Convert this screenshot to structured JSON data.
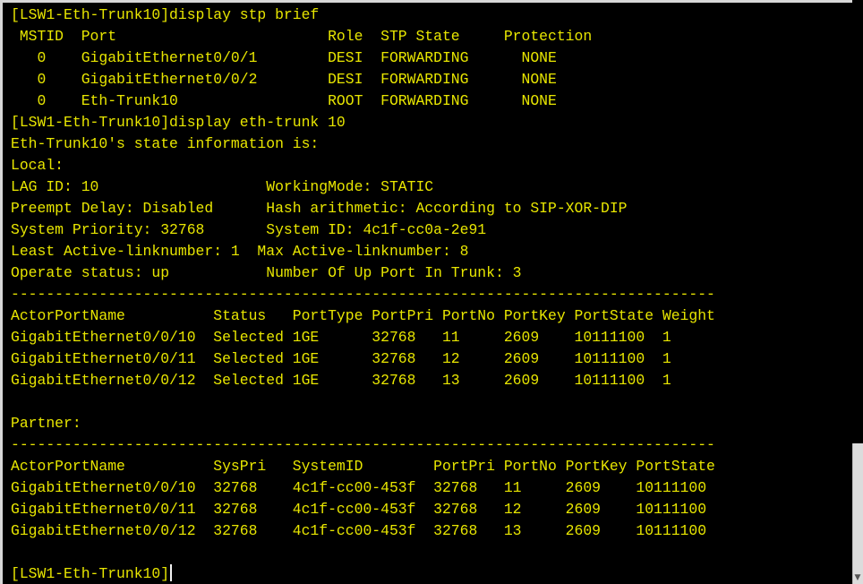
{
  "terminal": {
    "lines": [
      "[LSW1-Eth-Trunk10]display stp brief",
      " MSTID  Port                        Role  STP State     Protection",
      "   0    GigabitEthernet0/0/1        DESI  FORWARDING      NONE",
      "   0    GigabitEthernet0/0/2        DESI  FORWARDING      NONE",
      "   0    Eth-Trunk10                 ROOT  FORWARDING      NONE",
      "[LSW1-Eth-Trunk10]display eth-trunk 10",
      "Eth-Trunk10's state information is:",
      "Local:",
      "LAG ID: 10                   WorkingMode: STATIC",
      "Preempt Delay: Disabled      Hash arithmetic: According to SIP-XOR-DIP",
      "System Priority: 32768       System ID: 4c1f-cc0a-2e91",
      "Least Active-linknumber: 1  Max Active-linknumber: 8",
      "Operate status: up           Number Of Up Port In Trunk: 3",
      "--------------------------------------------------------------------------------",
      "ActorPortName          Status   PortType PortPri PortNo PortKey PortState Weight",
      "GigabitEthernet0/0/10  Selected 1GE      32768   11     2609    10111100  1",
      "GigabitEthernet0/0/11  Selected 1GE      32768   12     2609    10111100  1",
      "GigabitEthernet0/0/12  Selected 1GE      32768   13     2609    10111100  1",
      "",
      "Partner:",
      "--------------------------------------------------------------------------------",
      "ActorPortName          SysPri   SystemID        PortPri PortNo PortKey PortState",
      "GigabitEthernet0/0/10  32768    4c1f-cc00-453f  32768   11     2609    10111100",
      "GigabitEthernet0/0/11  32768    4c1f-cc00-453f  32768   12     2609    10111100",
      "GigabitEthernet0/0/12  32768    4c1f-cc00-453f  32768   13     2609    10111100",
      "",
      "[LSW1-Eth-Trunk10]"
    ]
  },
  "colors": {
    "background": "#000000",
    "text": "#e8e600"
  },
  "icons": {
    "scroll_down": "chevron-down-icon"
  }
}
